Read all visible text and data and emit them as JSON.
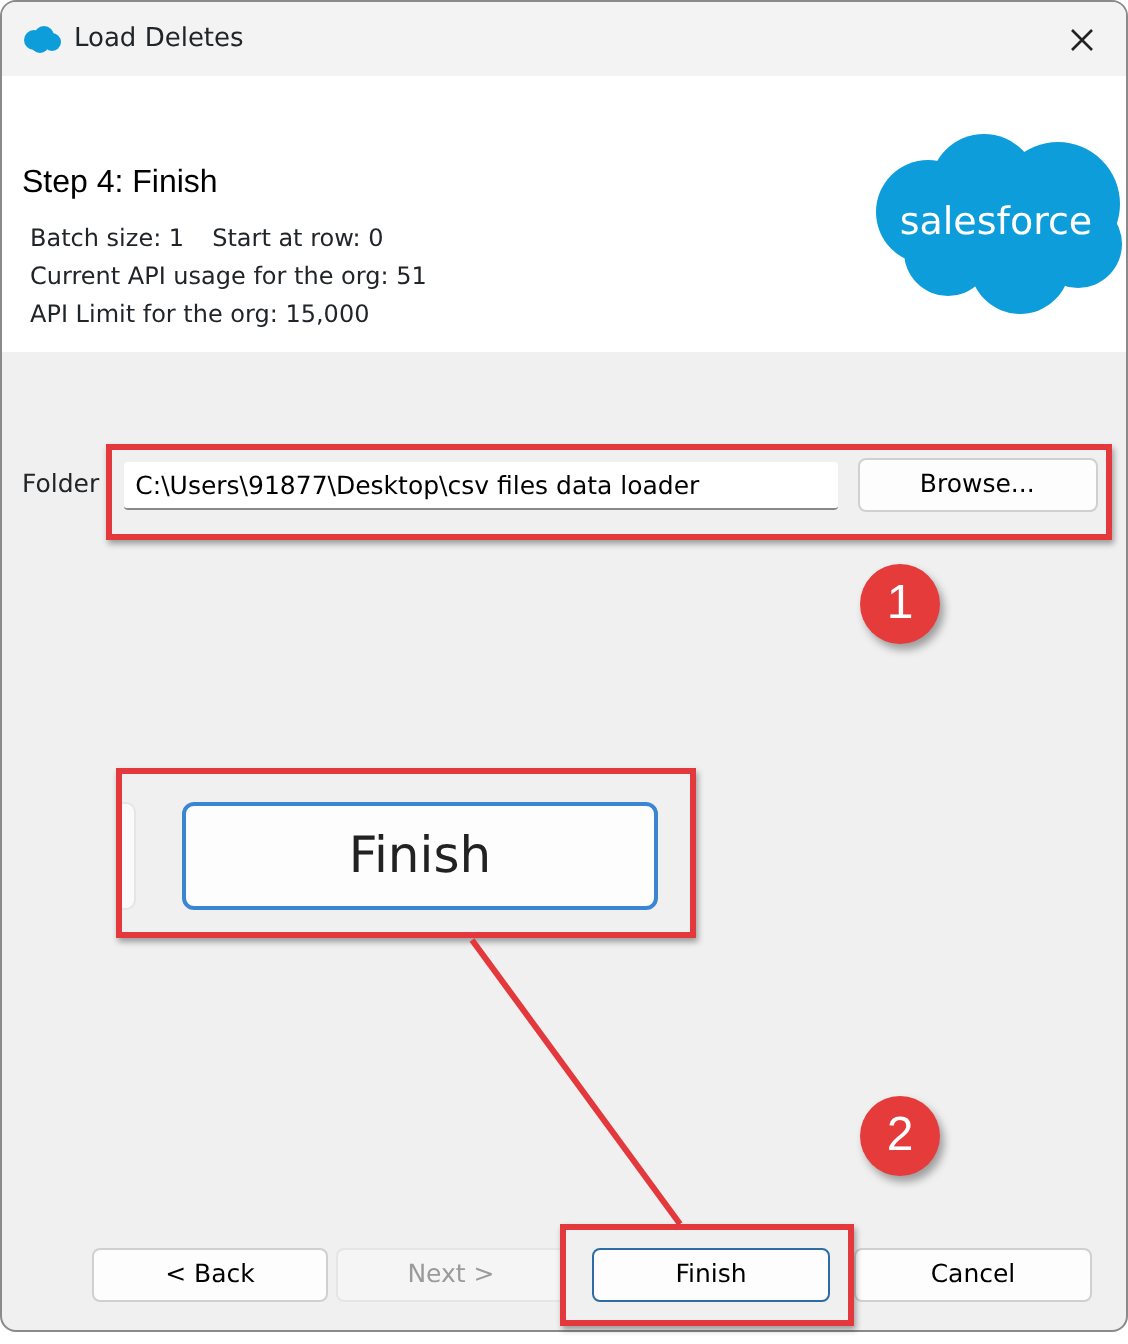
{
  "window": {
    "title": "Load Deletes"
  },
  "header": {
    "step_title": "Step 4: Finish",
    "logo_text": "salesforce",
    "info_lines": [
      [
        "Batch size: 1",
        "Start at row: 0"
      ],
      [
        "Current API usage for the org: 51"
      ],
      [
        "API Limit for the org: 15,000"
      ]
    ]
  },
  "folder": {
    "label": "Folder",
    "value": "C:\\Users\\91877\\Desktop\\csv files data loader",
    "button": "Browse..."
  },
  "buttons": [
    {
      "label": "< Back",
      "disabled": false,
      "focused": false
    },
    {
      "label": "Next >",
      "disabled": true,
      "focused": false
    },
    {
      "label": "Finish",
      "disabled": false,
      "focused": true
    },
    {
      "label": "Cancel",
      "disabled": false,
      "focused": false
    }
  ],
  "annotations": [
    {
      "kind": "marker",
      "text": "1"
    },
    {
      "kind": "callout",
      "text": "Finish"
    },
    {
      "kind": "marker",
      "text": "2"
    }
  ]
}
